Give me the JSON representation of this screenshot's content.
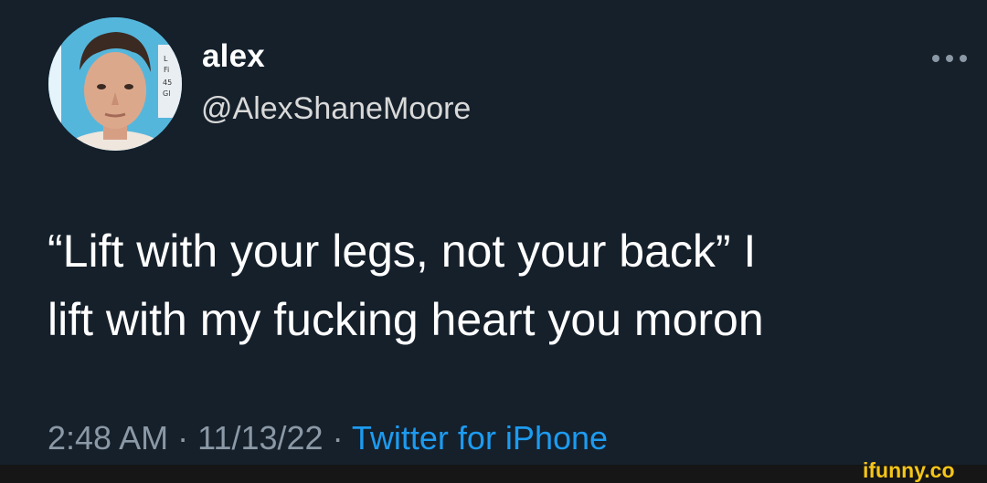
{
  "author": {
    "display_name": "alex",
    "handle": "@AlexShaneMoore",
    "avatar": "profile-photo"
  },
  "tweet": {
    "text": "“Lift with your legs, not your back” I\nlift with my fucking heart you moron"
  },
  "meta": {
    "time": "2:48 AM",
    "separator": " · ",
    "date": "11/13/22",
    "source": "Twitter for iPhone"
  },
  "icons": {
    "more": "more-horizontal-icon"
  },
  "watermark": {
    "text": "ifunny.co"
  },
  "colors": {
    "background": "#15202b",
    "text_primary": "#ffffff",
    "text_secondary": "#8b98a5",
    "link": "#1d9bf0",
    "watermark": "#f5c518"
  }
}
